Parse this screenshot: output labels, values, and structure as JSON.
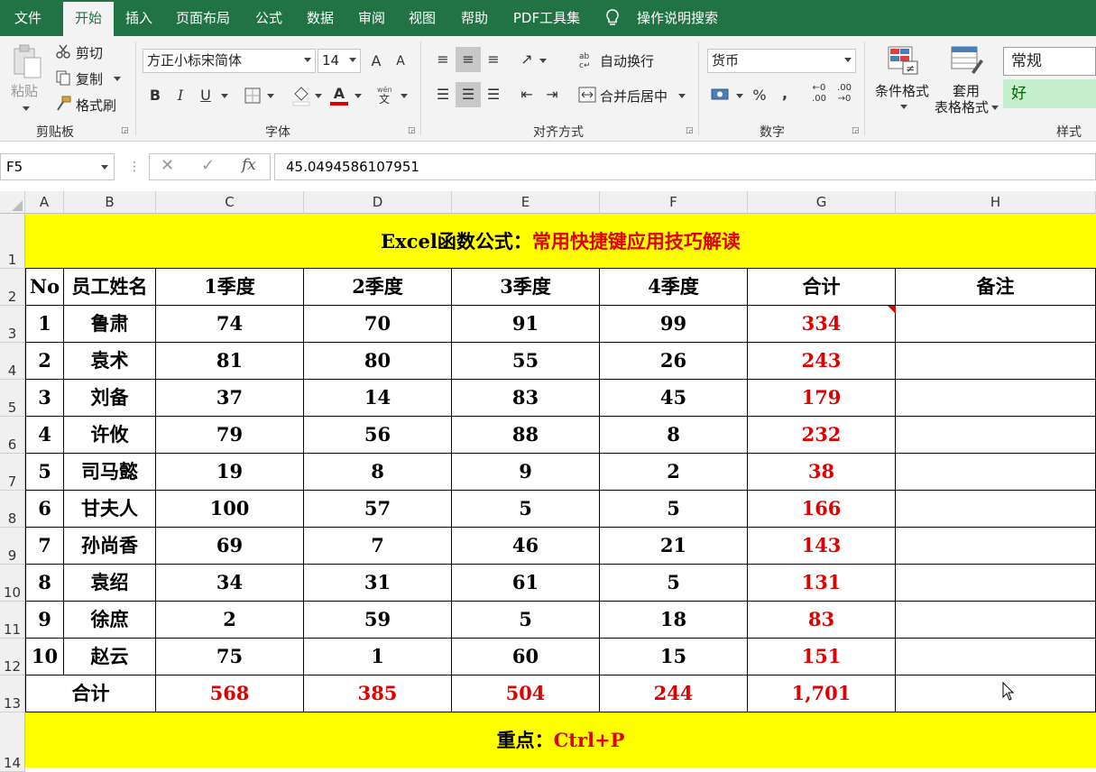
{
  "ribbon_tabs": [
    "文件",
    "开始",
    "插入",
    "页面布局",
    "公式",
    "数据",
    "审阅",
    "视图",
    "帮助",
    "PDF工具集"
  ],
  "active_tab": "开始",
  "tell_me": "操作说明搜索",
  "clipboard": {
    "paste": "粘贴",
    "cut": "剪切",
    "copy": "复制",
    "format_painter": "格式刷",
    "group": "剪贴板"
  },
  "font": {
    "name": "方正小标宋简体",
    "size": "14",
    "group": "字体",
    "bold": "B",
    "italic": "I",
    "underline": "U",
    "font_color_letter": "A",
    "grow": "A",
    "shrink": "A"
  },
  "alignment": {
    "wrap": "自动换行",
    "merge": "合并后居中",
    "group": "对齐方式"
  },
  "number": {
    "format": "货币",
    "percent": "%",
    "comma": ",",
    "group": "数字"
  },
  "styles": {
    "conditional": "条件格式",
    "table_format_1": "套用",
    "table_format_2": "表格格式",
    "normal": "常规",
    "good": "好",
    "group": "样式"
  },
  "formula_bar": {
    "name_box": "F5",
    "cancel": "✕",
    "enter": "✓",
    "fx": "fx",
    "value": "45.0494586107951"
  },
  "columns": [
    "A",
    "B",
    "C",
    "D",
    "E",
    "F",
    "G",
    "H"
  ],
  "rows": [
    "1",
    "2",
    "3",
    "4",
    "5",
    "6",
    "7",
    "8",
    "9",
    "10",
    "11",
    "12",
    "13",
    "14"
  ],
  "sheet": {
    "title_black": "Excel函数公式：",
    "title_red": "常用快捷键应用技巧解读",
    "headers": [
      "No",
      "员工姓名",
      "1季度",
      "2季度",
      "3季度",
      "4季度",
      "合计",
      "备注"
    ],
    "data": [
      [
        "1",
        "鲁肃",
        "74",
        "70",
        "91",
        "99",
        "334",
        ""
      ],
      [
        "2",
        "袁术",
        "81",
        "80",
        "55",
        "26",
        "243",
        ""
      ],
      [
        "3",
        "刘备",
        "37",
        "14",
        "83",
        "45",
        "179",
        ""
      ],
      [
        "4",
        "许攸",
        "79",
        "56",
        "88",
        "8",
        "232",
        ""
      ],
      [
        "5",
        "司马懿",
        "19",
        "8",
        "9",
        "2",
        "38",
        ""
      ],
      [
        "6",
        "甘夫人",
        "100",
        "57",
        "5",
        "5",
        "166",
        ""
      ],
      [
        "7",
        "孙尚香",
        "69",
        "7",
        "46",
        "21",
        "143",
        ""
      ],
      [
        "8",
        "袁绍",
        "34",
        "31",
        "61",
        "5",
        "131",
        ""
      ],
      [
        "9",
        "徐庶",
        "2",
        "59",
        "5",
        "18",
        "83",
        ""
      ],
      [
        "10",
        "赵云",
        "75",
        "1",
        "60",
        "15",
        "151",
        ""
      ]
    ],
    "total_label": "合计",
    "totals": [
      "568",
      "385",
      "504",
      "244",
      "1,701",
      ""
    ],
    "note_black": "重点：",
    "note_red": "Ctrl+P"
  },
  "colors": {
    "excel_green": "#217346",
    "highlight_yellow": "#ffff00",
    "emphasis_red": "#e00000"
  }
}
